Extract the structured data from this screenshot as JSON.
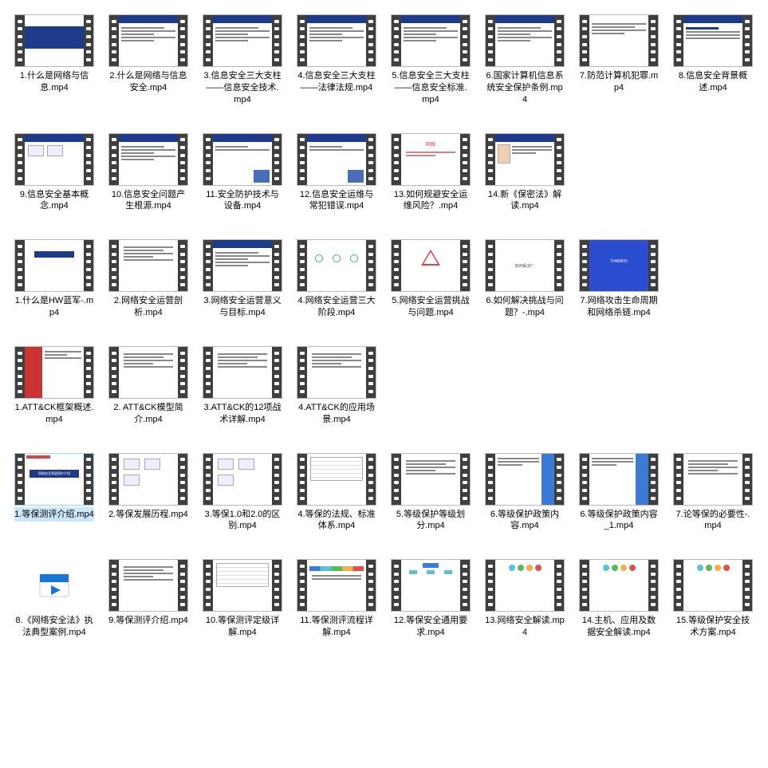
{
  "files": [
    {
      "name": "1.什么是网络与信息.mp4",
      "type": "video",
      "selected": false,
      "style": "title-blue"
    },
    {
      "name": "2.什么是网络与信息安全.mp4",
      "type": "video",
      "selected": false,
      "style": "header-bullets"
    },
    {
      "name": "3.信息安全三大支柱——信息安全技术.mp4",
      "type": "video",
      "selected": false,
      "style": "header-bullets"
    },
    {
      "name": "4.信息安全三大支柱——法律法规.mp4",
      "type": "video",
      "selected": false,
      "style": "header-bullets"
    },
    {
      "name": "5.信息安全三大支柱——信息安全标准.mp4",
      "type": "video",
      "selected": false,
      "style": "header-bullets"
    },
    {
      "name": "6.国家计算机信息系统安全保护条例.mp4",
      "type": "video",
      "selected": false,
      "style": "header-bullets"
    },
    {
      "name": "7.防范计算机犯罪.mp4",
      "type": "video",
      "selected": false,
      "style": "plain-text"
    },
    {
      "name": "8.信息安全背景概述.mp4",
      "type": "video",
      "selected": false,
      "style": "header-list"
    },
    {
      "name": "9.信息安全基本概念.mp4",
      "type": "video",
      "selected": false,
      "style": "header-pics"
    },
    {
      "name": "10.信息安全问题产生根源.mp4",
      "type": "video",
      "selected": false,
      "style": "header-bullets"
    },
    {
      "name": "11.安全防护技术与设备.mp4",
      "type": "video",
      "selected": false,
      "style": "header-pic"
    },
    {
      "name": "12.信息安全运维与常犯错误.mp4",
      "type": "video",
      "selected": false,
      "style": "header-pic"
    },
    {
      "name": "13.如何规避安全运维风险？.mp4",
      "type": "video",
      "selected": false,
      "style": "red-text"
    },
    {
      "name": "14.新《保密法》解读.mp4",
      "type": "video",
      "selected": false,
      "style": "header-doc"
    },
    {
      "name": "1.什么是HW蓝军-.mp4",
      "type": "video",
      "selected": false,
      "style": "white-logo"
    },
    {
      "name": "2.网络安全运营剖析.mp4",
      "type": "video",
      "selected": false,
      "style": "white-text"
    },
    {
      "name": "3.网络安全运营意义与目标.mp4",
      "type": "video",
      "selected": false,
      "style": "header-bullets"
    },
    {
      "name": "4.网络安全运营三大阶段.mp4",
      "type": "video",
      "selected": false,
      "style": "circles"
    },
    {
      "name": "5.网络安全运营挑战与问题.mp4",
      "type": "video",
      "selected": false,
      "style": "triangle"
    },
    {
      "name": "6.如何解决挑战与问题？-.mp4",
      "type": "video",
      "selected": false,
      "style": "center-text"
    },
    {
      "name": "7.网络攻击生命周期和网络杀链.mp4",
      "type": "video",
      "selected": false,
      "style": "thanks-blue"
    },
    {
      "name": "1.ATT&CK框架概述.mp4",
      "type": "video",
      "selected": false,
      "style": "sidebar"
    },
    {
      "name": "2. ATT&CK模型简介.mp4",
      "type": "video",
      "selected": false,
      "style": "white-text"
    },
    {
      "name": "3.ATT&CK的12项战术详解.mp4",
      "type": "video",
      "selected": false,
      "style": "white-text"
    },
    {
      "name": "4.ATT&CK的应用场景.mp4",
      "type": "video",
      "selected": false,
      "style": "white-text"
    },
    {
      "name": "1.等保测评介绍.mp4",
      "type": "video",
      "selected": true,
      "style": "title-bar"
    },
    {
      "name": "2.等保发展历程.mp4",
      "type": "video",
      "selected": false,
      "style": "boxes"
    },
    {
      "name": "3.等保1.0和2.0的区别.mp4",
      "type": "video",
      "selected": false,
      "style": "boxes"
    },
    {
      "name": "4.等保的法规、标准体系.mp4",
      "type": "video",
      "selected": false,
      "style": "table"
    },
    {
      "name": "5.等级保护等级划分.mp4",
      "type": "video",
      "selected": false,
      "style": "white-text"
    },
    {
      "name": "6.等级保护政策内容.mp4",
      "type": "video",
      "selected": false,
      "style": "side-bar"
    },
    {
      "name": "6.等级保护政策内容_1.mp4",
      "type": "video",
      "selected": false,
      "style": "side-bar"
    },
    {
      "name": "7.论等保的必要性-.mp4",
      "type": "video",
      "selected": false,
      "style": "white-text"
    },
    {
      "name": "8.《网络安全法》执法典型案例.mp4",
      "type": "app-icon",
      "selected": false,
      "style": "app"
    },
    {
      "name": "9.等保测评介绍.mp4",
      "type": "video",
      "selected": false,
      "style": "white-text"
    },
    {
      "name": "10.等保测评定级详解.mp4",
      "type": "video",
      "selected": false,
      "style": "table"
    },
    {
      "name": "11.等保测评流程详解.mp4",
      "type": "video",
      "selected": false,
      "style": "flow"
    },
    {
      "name": "12.等保安全通用要求.mp4",
      "type": "video",
      "selected": false,
      "style": "tree"
    },
    {
      "name": "13.网络安全解读.mp4",
      "type": "video",
      "selected": false,
      "style": "diagram"
    },
    {
      "name": "14.主机、应用及数据安全解读.mp4",
      "type": "video",
      "selected": false,
      "style": "diagram"
    },
    {
      "name": "15.等级保护安全技术方案.mp4",
      "type": "video",
      "selected": false,
      "style": "diagram"
    }
  ],
  "row_layout": [
    8,
    6,
    7,
    4,
    8,
    8
  ]
}
